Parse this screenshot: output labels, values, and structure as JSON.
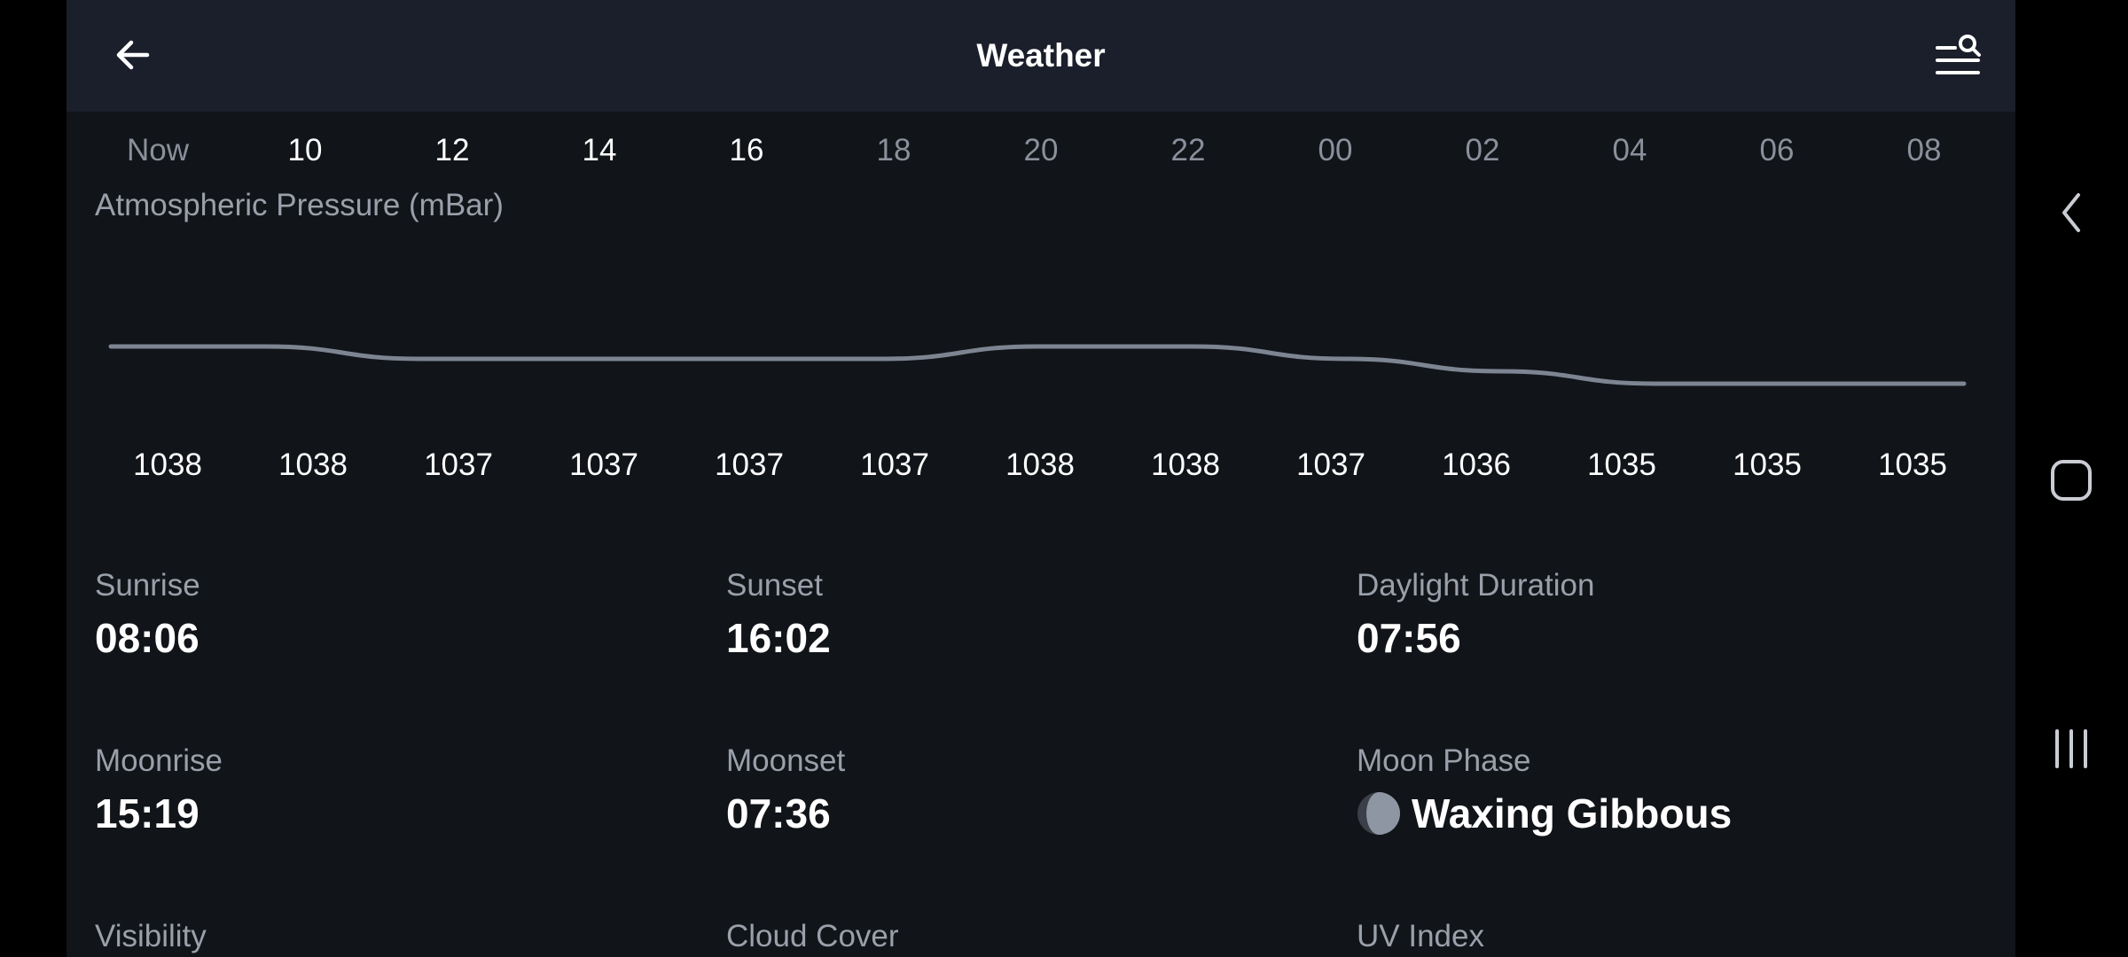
{
  "header": {
    "title": "Weather"
  },
  "timeline": {
    "hours": [
      "Now",
      "10",
      "12",
      "14",
      "16",
      "18",
      "20",
      "22",
      "00",
      "02",
      "04",
      "06",
      "08"
    ]
  },
  "pressure": {
    "label": "Atmospheric Pressure (mBar)",
    "values": [
      "1038",
      "1038",
      "1037",
      "1037",
      "1037",
      "1037",
      "1038",
      "1038",
      "1037",
      "1036",
      "1035",
      "1035",
      "1035"
    ]
  },
  "chart_data": {
    "type": "line",
    "x": [
      "Now",
      "10",
      "12",
      "14",
      "16",
      "18",
      "20",
      "22",
      "00",
      "02",
      "04",
      "06",
      "08"
    ],
    "series": [
      {
        "values": [
          1038,
          1038,
          1037,
          1037,
          1037,
          1037,
          1038,
          1038,
          1037,
          1036,
          1035,
          1035,
          1035
        ]
      }
    ],
    "title": "Atmospheric Pressure (mBar)",
    "ylim": [
      1030,
      1045
    ],
    "grid": false,
    "line_color": "#7c8591"
  },
  "details": {
    "sunrise": {
      "label": "Sunrise",
      "value": "08:06"
    },
    "sunset": {
      "label": "Sunset",
      "value": "16:02"
    },
    "daylight": {
      "label": "Daylight Duration",
      "value": "07:56"
    },
    "moonrise": {
      "label": "Moonrise",
      "value": "15:19"
    },
    "moonset": {
      "label": "Moonset",
      "value": "07:36"
    },
    "moon_phase": {
      "label": "Moon Phase",
      "value": "Waxing Gibbous",
      "icon": "moon-waxing-gibbous-icon"
    },
    "visibility": {
      "label": "Visibility"
    },
    "cloud_cover": {
      "label": "Cloud Cover"
    },
    "uv_index": {
      "label": "UV Index"
    }
  },
  "icons": {
    "back": "arrow-left-icon",
    "search": "search-list-icon",
    "nav_back": "chevron-left-icon",
    "nav_home": "home-icon",
    "nav_recents": "recents-icon"
  },
  "colors": {
    "background": "#111419",
    "topbar": "#1b1f2b",
    "muted_text": "#9aa0aa",
    "text": "#ffffff"
  }
}
